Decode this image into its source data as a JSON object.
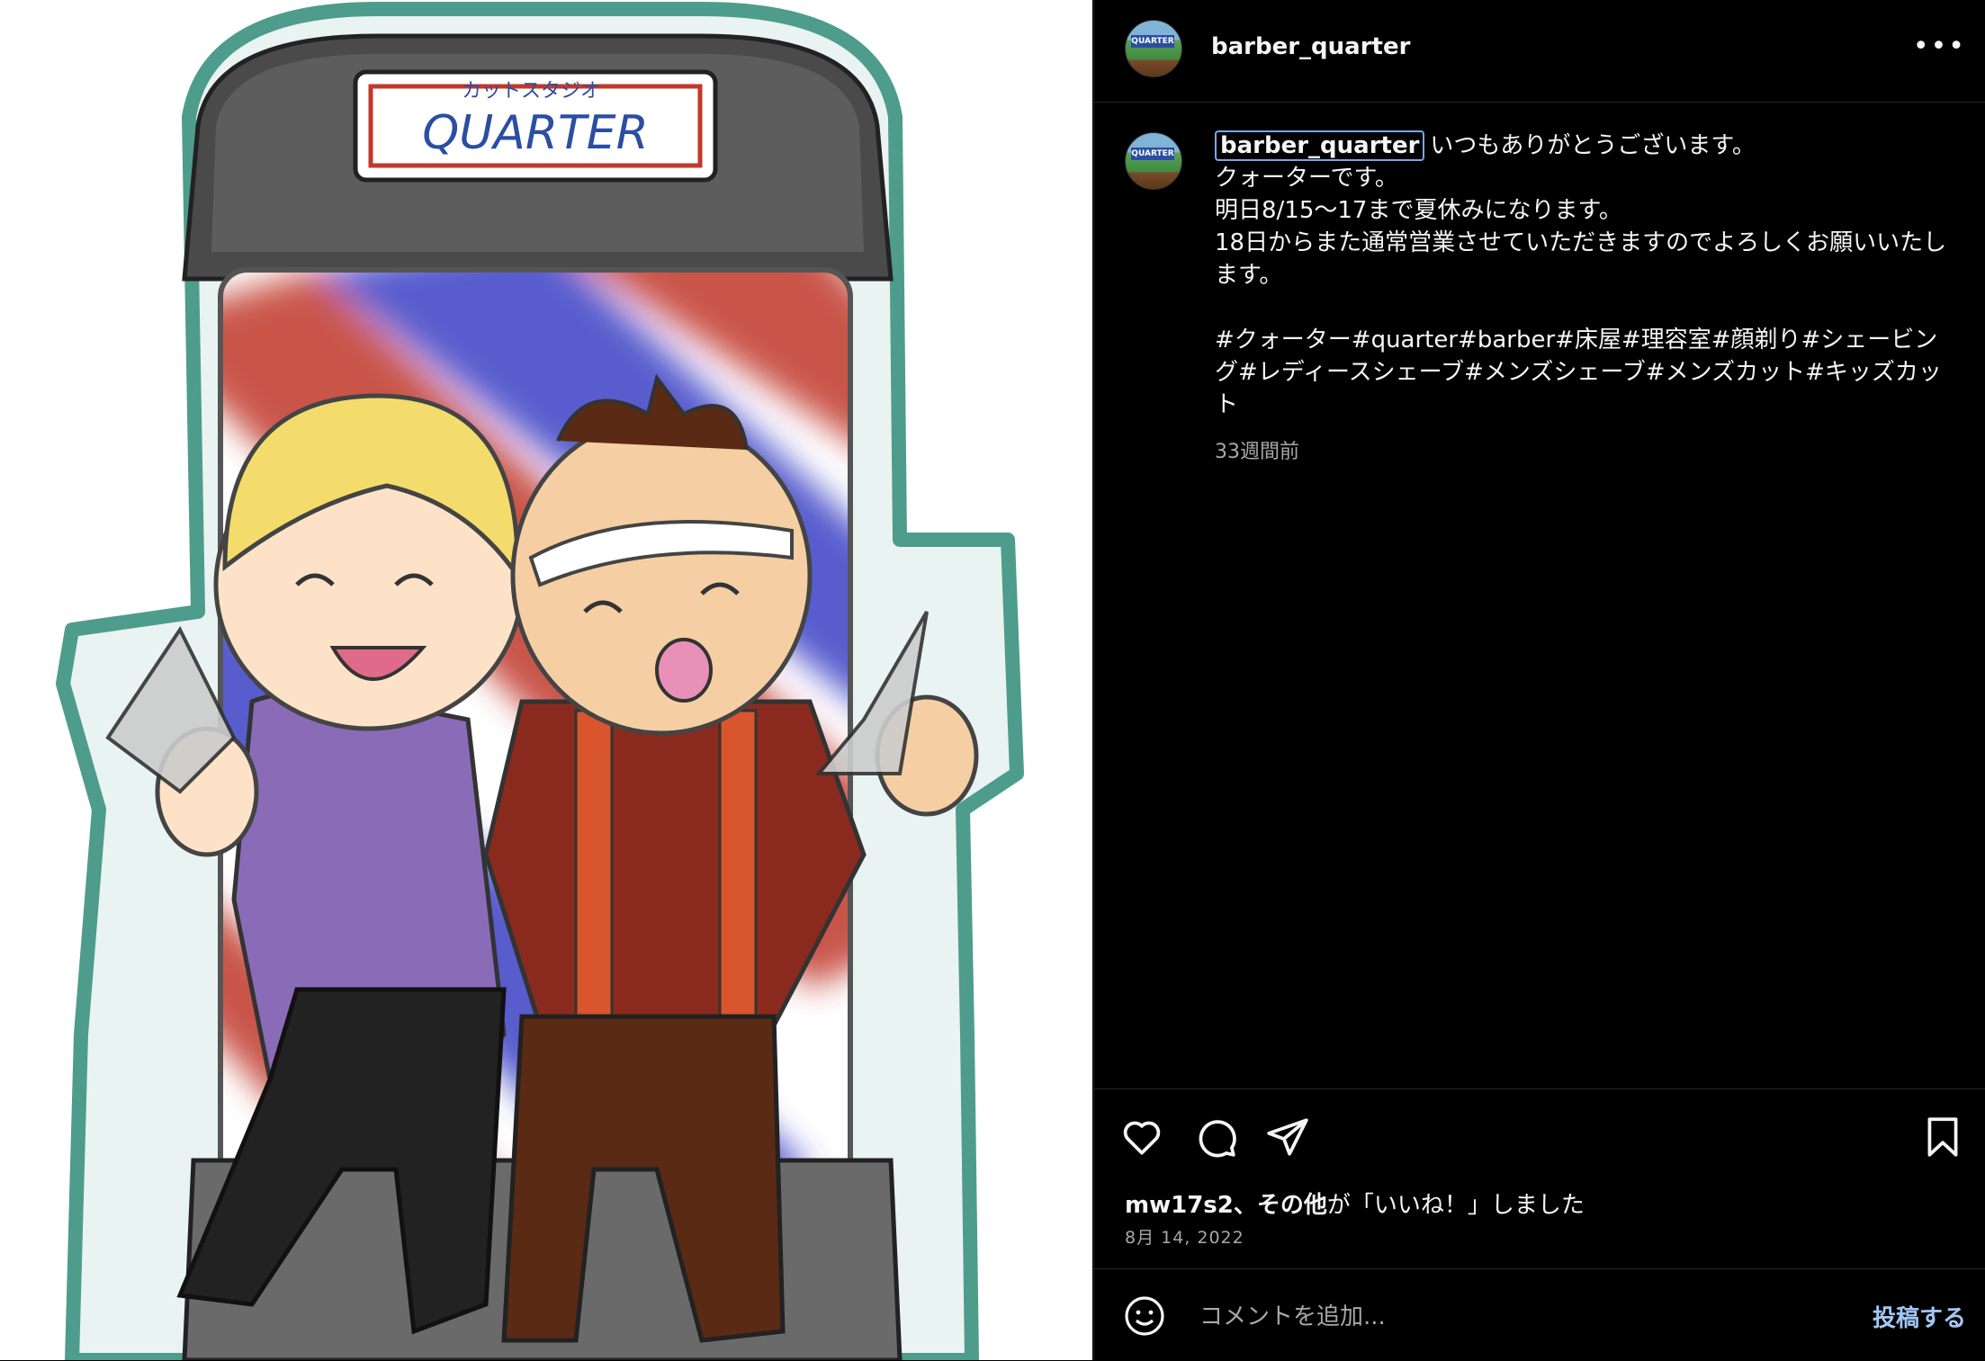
{
  "post_image": {
    "sign_small_text": "カットスタジオ",
    "sign_main_text": "QUARTER"
  },
  "header": {
    "username": "barber_quarter",
    "more_label": "•••"
  },
  "avatar": {
    "sign_text": "QUARTER"
  },
  "caption": {
    "username": "barber_quarter",
    "text": "いつもありがとうございます。\nクォーターです。\n明日8/15〜17まで夏休みになります。\n18日からまた通常営業させていただきますのでよろしくお願いいたします。\n\n#クォーター#quarter#barber#床屋#理容室#顔剃り#シェービング#レディースシェーブ#メンズシェーブ#メンズカット#キッズカット",
    "time_ago": "33週間前"
  },
  "actions": {
    "icons": [
      "heart-icon",
      "comment-icon",
      "share-icon",
      "bookmark-icon"
    ]
  },
  "likes": {
    "user": "mw17s2、その他",
    "suffix": "が「いいね！」しました"
  },
  "post_date": "8月 14, 2022",
  "comment": {
    "placeholder": "コメントを追加...",
    "post_label": "投稿する"
  },
  "colors": {
    "background": "#000000",
    "text": "#f5f5f5",
    "muted": "#a8a8a8",
    "post_button": "#a4c7f5"
  }
}
